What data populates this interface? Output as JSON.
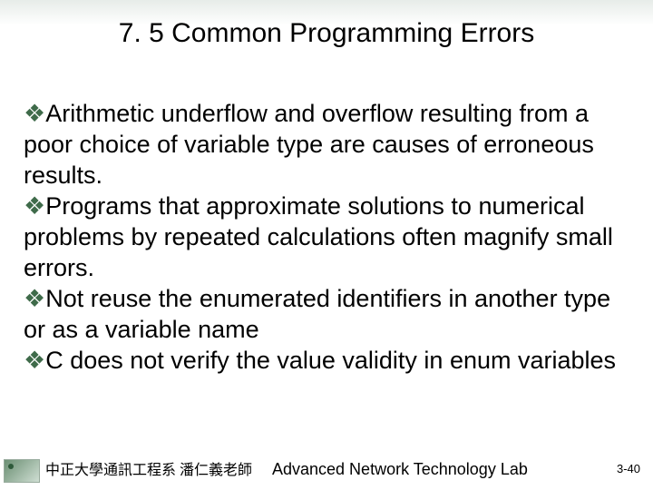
{
  "title": "7. 5 Common Programming Errors",
  "bullets": [
    "Arithmetic underflow and overflow resulting from a poor choice of variable type are causes of erroneous results.",
    "Programs that approximate solutions to numerical problems by repeated calculations often magnify small errors.",
    "Not reuse the enumerated identifiers in another type or as a variable name",
    "C does not verify the value validity in enum variables"
  ],
  "bullet_marker": "❖",
  "footer": {
    "left": "中正大學通訊工程系 潘仁義老師",
    "center": "Advanced Network Technology Lab",
    "right": "3-40"
  }
}
